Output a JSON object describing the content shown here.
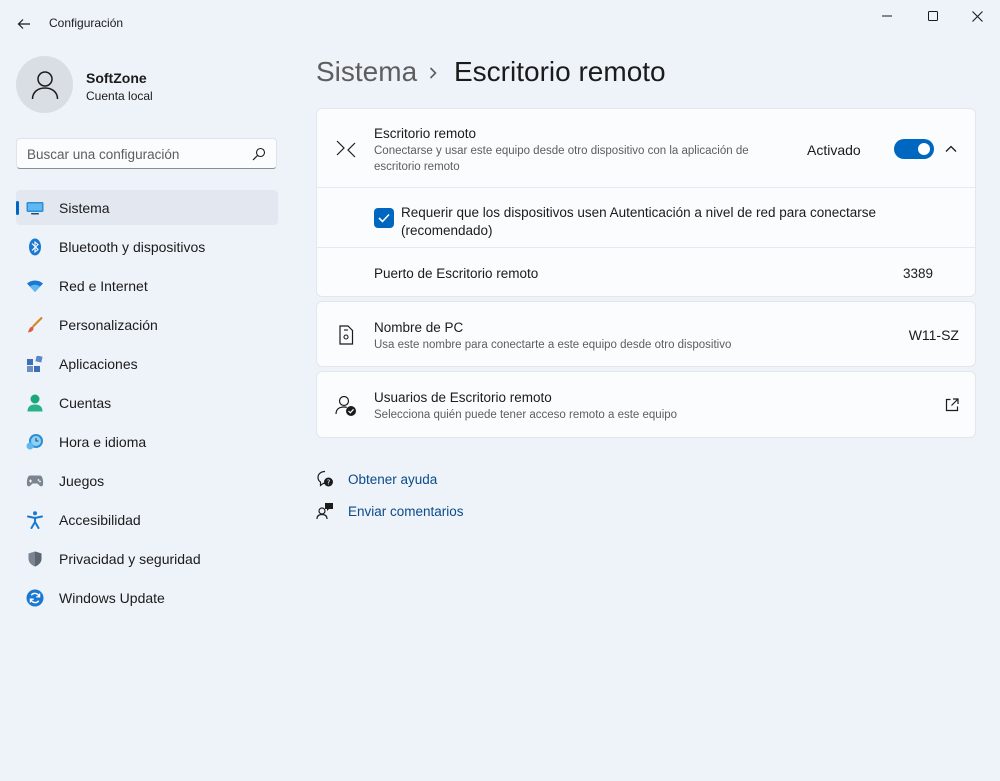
{
  "window": {
    "title": "Configuración",
    "controls": [
      "minimize",
      "maximize",
      "close"
    ]
  },
  "profile": {
    "name": "SoftZone",
    "account_type": "Cuenta local"
  },
  "search": {
    "placeholder": "Buscar una configuración"
  },
  "sidebar": {
    "items": [
      {
        "label": "Sistema",
        "icon": "system-icon",
        "active": true
      },
      {
        "label": "Bluetooth y dispositivos",
        "icon": "bluetooth-icon"
      },
      {
        "label": "Red e Internet",
        "icon": "wifi-icon"
      },
      {
        "label": "Personalización",
        "icon": "brush-icon"
      },
      {
        "label": "Aplicaciones",
        "icon": "apps-icon"
      },
      {
        "label": "Cuentas",
        "icon": "accounts-icon"
      },
      {
        "label": "Hora e idioma",
        "icon": "time-language-icon"
      },
      {
        "label": "Juegos",
        "icon": "gamepad-icon"
      },
      {
        "label": "Accesibilidad",
        "icon": "accessibility-icon"
      },
      {
        "label": "Privacidad y seguridad",
        "icon": "shield-icon"
      },
      {
        "label": "Windows Update",
        "icon": "update-icon"
      }
    ]
  },
  "breadcrumb": {
    "parent": "Sistema",
    "current": "Escritorio remoto"
  },
  "remote_desktop": {
    "title": "Escritorio remoto",
    "description": "Conectarse y usar este equipo desde otro dispositivo con la aplicación de escritorio remoto",
    "toggle_label": "Activado",
    "toggle_on": true,
    "nla_label": "Requerir que los dispositivos usen Autenticación a nivel de red para conectarse (recomendado)",
    "nla_checked": true,
    "port_label": "Puerto de Escritorio remoto",
    "port_value": "3389"
  },
  "pc_name": {
    "title": "Nombre de PC",
    "description": "Usa este nombre para conectarte a este equipo desde otro dispositivo",
    "value": "W11-SZ"
  },
  "remote_users": {
    "title": "Usuarios de Escritorio remoto",
    "description": "Selecciona quién puede tener acceso remoto a este equipo"
  },
  "links": {
    "help": "Obtener ayuda",
    "feedback": "Enviar comentarios"
  },
  "colors": {
    "accent": "#0067c0",
    "background": "#eef2f9",
    "card": "#fbfcfd",
    "link": "#0a4b8a"
  }
}
